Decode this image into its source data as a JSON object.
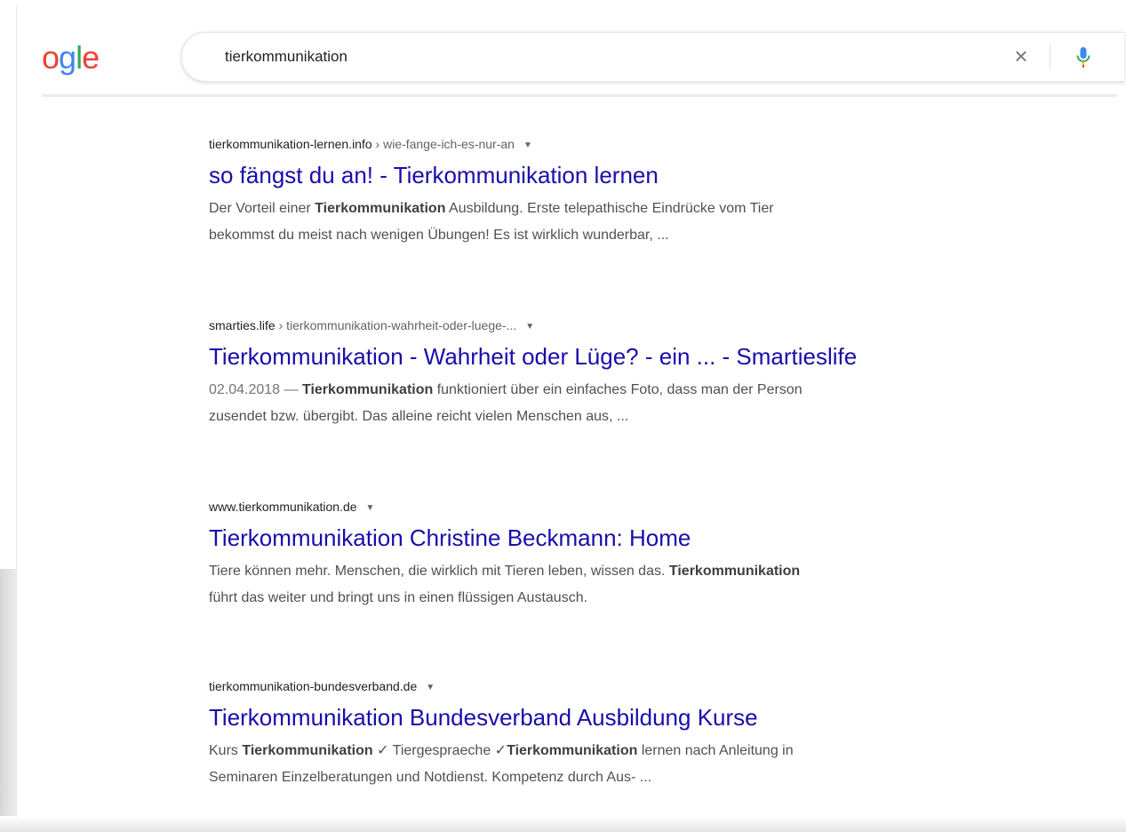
{
  "logo": {
    "letters": [
      {
        "char": "o",
        "color": "#ea4335"
      },
      {
        "char": "g",
        "color": "#4285f4"
      },
      {
        "char": "l",
        "color": "#34a853"
      },
      {
        "char": "e",
        "color": "#ea4335"
      }
    ]
  },
  "search": {
    "query": "tierkommunikation",
    "clear_icon": "close-icon",
    "clear_glyph": "×",
    "mic_icon": "microphone-icon"
  },
  "colors": {
    "link": "#1a0dab",
    "snippet": "#4d5156",
    "cite": "#202124"
  },
  "results": [
    {
      "domain": "tierkommunikation-lernen.info",
      "path": " › wie-fange-ich-es-nur-an",
      "arrow": "▼",
      "title": "so fängst du an! - Tierkommunikation lernen",
      "line1": [
        {
          "t": "Der Vorteil einer ",
          "b": false
        },
        {
          "t": "Tierkommunikation",
          "b": true
        },
        {
          "t": " Ausbildung. Erste telepathische Eindrücke vom Tier",
          "b": false
        }
      ],
      "line2": [
        {
          "t": "bekommst du meist nach wenigen Übungen! Es ist wirklich wunderbar, ...",
          "b": false
        }
      ]
    },
    {
      "domain": "smarties.life",
      "path": " › tierkommunikation-wahrheit-oder-luege-...",
      "arrow": "▼",
      "title": "Tierkommunikation - Wahrheit oder Lüge? - ein ... - Smartieslife",
      "date": "02.04.2018 — ",
      "line1": [
        {
          "t": "Tierkommunikation",
          "b": true
        },
        {
          "t": " funktioniert über ein einfaches Foto, dass man der Person",
          "b": false
        }
      ],
      "line2": [
        {
          "t": "zusendet bzw. übergibt. Das alleine reicht vielen Menschen aus, ...",
          "b": false
        }
      ]
    },
    {
      "domain": "www.tierkommunikation.de",
      "path": "",
      "arrow": "▼",
      "title": "Tierkommunikation Christine Beckmann: Home",
      "line1": [
        {
          "t": "Tiere können mehr. Menschen, die wirklich mit Tieren leben, wissen das. ",
          "b": false
        },
        {
          "t": "Tierkommunikation",
          "b": true
        }
      ],
      "line2": [
        {
          "t": "führt das weiter und bringt uns in einen flüssigen Austausch.",
          "b": false
        }
      ]
    },
    {
      "domain": "tierkommunikation-bundesverband.de",
      "path": "",
      "arrow": "▼",
      "title": "Tierkommunikation Bundesverband Ausbildung Kurse",
      "line1": [
        {
          "t": "Kurs ",
          "b": false
        },
        {
          "t": "Tierkommunikation",
          "b": true
        },
        {
          "t": " ✓ Tiergespraeche ✓",
          "b": false
        },
        {
          "t": "Tierkommunikation",
          "b": true
        },
        {
          "t": " lernen nach Anleitung in",
          "b": false
        }
      ],
      "line2": [
        {
          "t": "Seminaren Einzelberatungen und Notdienst. Kompetenz durch Aus- ...",
          "b": false
        }
      ]
    }
  ]
}
